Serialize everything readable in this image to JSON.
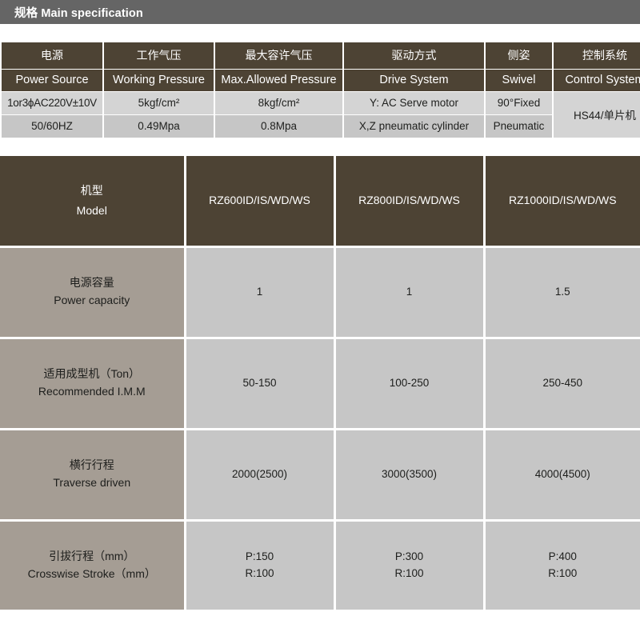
{
  "titlebar": {
    "title": "规格 Main specification"
  },
  "spec_table": {
    "columns": [
      {
        "cn": "电源",
        "en": "Power Source",
        "row1": "1or3ϕAC220V±10V",
        "row2": "50/60HZ"
      },
      {
        "cn": "工作气压",
        "en": "Working Pressure",
        "row1": "5kgf/cm²",
        "row2": "0.49Mpa"
      },
      {
        "cn": "最大容许气压",
        "en": "Max.Allowed Pressure",
        "row1": "8kgf/cm²",
        "row2": "0.8Mpa"
      },
      {
        "cn": "驱动方式",
        "en": "Drive System",
        "row1": "Y: AC Serve motor",
        "row2": "X,Z pneumatic cylinder"
      },
      {
        "cn": "侧姿",
        "en": "Swivel",
        "row1": "90°Fixed",
        "row2": "Pneumatic"
      },
      {
        "cn": "控制系统",
        "en": "Control System",
        "row1": "HS44/单片机",
        "row2": ""
      }
    ]
  },
  "model_table": {
    "header": {
      "label_cn": "机型",
      "label_en": "Model",
      "models": [
        "RZ600ID/IS/WD/WS",
        "RZ800ID/IS/WD/WS",
        "RZ1000ID/IS/WD/WS"
      ]
    },
    "rows": [
      {
        "label_cn": "电源容量",
        "label_en": "Power capacity",
        "values": [
          "1",
          "1",
          "1.5"
        ],
        "values2": [
          "",
          "",
          ""
        ]
      },
      {
        "label_cn": "适用成型机（Ton）",
        "label_en": "Recommended I.M.M",
        "values": [
          "50-150",
          "100-250",
          "250-450"
        ],
        "values2": [
          "",
          "",
          ""
        ]
      },
      {
        "label_cn": "横行行程",
        "label_en": "Traverse driven",
        "values": [
          "2000(2500)",
          "3000(3500)",
          "4000(4500)"
        ],
        "values2": [
          "",
          "",
          ""
        ]
      },
      {
        "label_cn": "引拔行程（mm）",
        "label_en": "Crosswise Stroke（mm）",
        "values": [
          "P:150",
          "P:300",
          "P:400"
        ],
        "values2": [
          "R:100",
          "R:100",
          "R:100"
        ]
      }
    ]
  },
  "colors": {
    "titlebar_bg": "#656565",
    "header_brown": "#4d4334",
    "label_taupe": "#a59d94",
    "value_grey": "#c6c6c6",
    "row_light_grey": "#d4d4d4",
    "page_bg": "#ffffff"
  }
}
